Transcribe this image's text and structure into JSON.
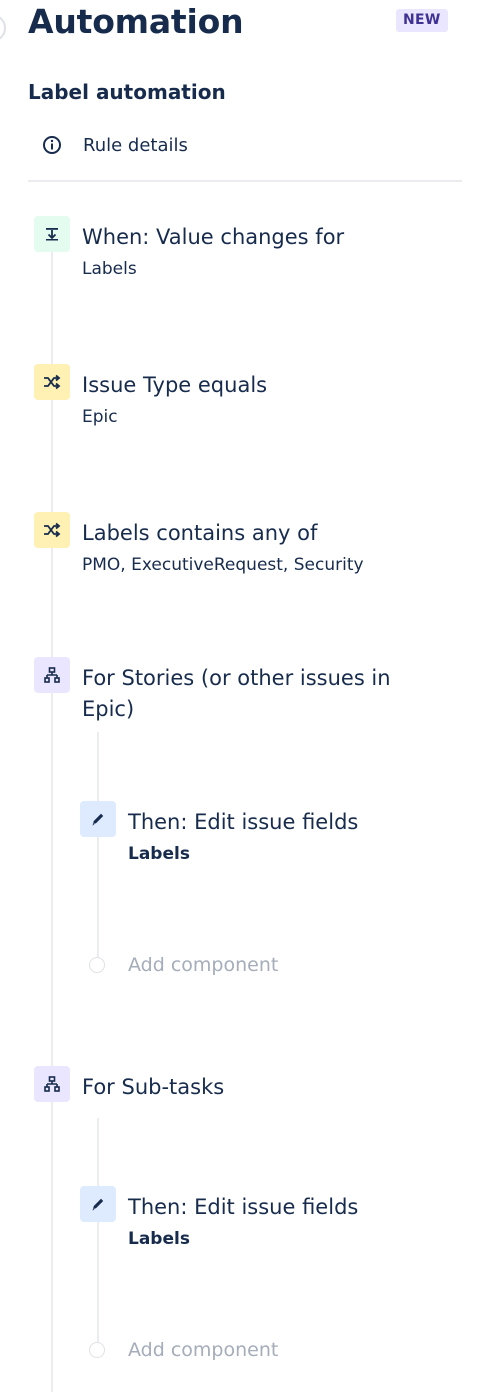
{
  "header": {
    "title": "Automation",
    "badge": "NEW"
  },
  "rule": {
    "name": "Label automation",
    "details_label": "Rule details"
  },
  "steps": [
    {
      "kind": "trigger",
      "icon": "download-arrow-icon",
      "title": "When: Value changes for",
      "subtitle": "Labels"
    },
    {
      "kind": "condition",
      "icon": "shuffle-icon",
      "title": "Issue Type equals",
      "subtitle": "Epic"
    },
    {
      "kind": "condition",
      "icon": "shuffle-icon",
      "title": "Labels contains any of",
      "subtitle": "PMO, ExecutiveRequest, Security"
    },
    {
      "kind": "branch",
      "icon": "hierarchy-icon",
      "title_line1": "For Stories (or other issues in",
      "title_line2": "Epic)"
    },
    {
      "kind": "action",
      "icon": "pencil-icon",
      "title": "Then: Edit issue fields",
      "subtitle": "Labels"
    },
    {
      "kind": "add",
      "label": "Add component"
    },
    {
      "kind": "branch",
      "icon": "hierarchy-icon",
      "title": "For Sub-tasks"
    },
    {
      "kind": "action",
      "icon": "pencil-icon",
      "title": "Then: Edit issue fields",
      "subtitle": "Labels"
    },
    {
      "kind": "add",
      "label": "Add component"
    }
  ],
  "colors": {
    "text": "#172b4d",
    "badge_bg": "#eae6ff",
    "badge_text": "#403294",
    "trigger_bg": "#e3fcef",
    "condition_bg": "#fff0b3",
    "branch_bg": "#eae6ff",
    "action_bg": "#deebff",
    "muted": "#a5adba"
  }
}
